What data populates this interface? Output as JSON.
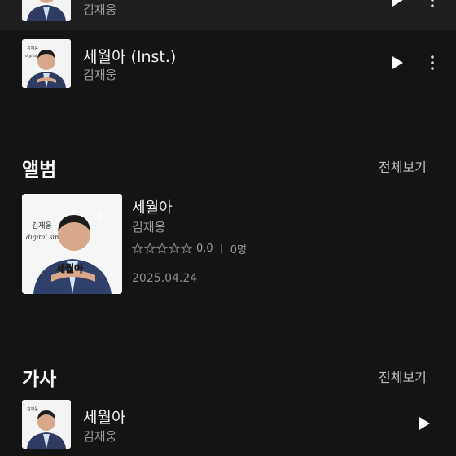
{
  "top_track": {
    "artist": "김재웅"
  },
  "tracks": [
    {
      "title": "세월아 (Inst.)",
      "artist": "김재웅"
    }
  ],
  "album_section": {
    "title": "앨범",
    "see_all": "전체보기",
    "album": {
      "title": "세월아",
      "artist": "김재웅",
      "rating": "0.0",
      "rating_stars_filled": 0,
      "rating_count": "0명",
      "date": "2025.04.24",
      "cover_text": {
        "small": "김재웅",
        "subtitle": "digital single",
        "title": "세월아"
      }
    }
  },
  "lyrics_section": {
    "title": "가사",
    "see_all": "전체보기",
    "track": {
      "title": "세월아",
      "artist": "김재웅"
    }
  },
  "colors": {
    "background": "#141414",
    "top_strip": "#1f1f1f",
    "secondary_text": "#9a9a9a"
  },
  "icons": {
    "play": "play-icon",
    "more": "more-vertical-icon",
    "star": "star-outline-icon"
  }
}
